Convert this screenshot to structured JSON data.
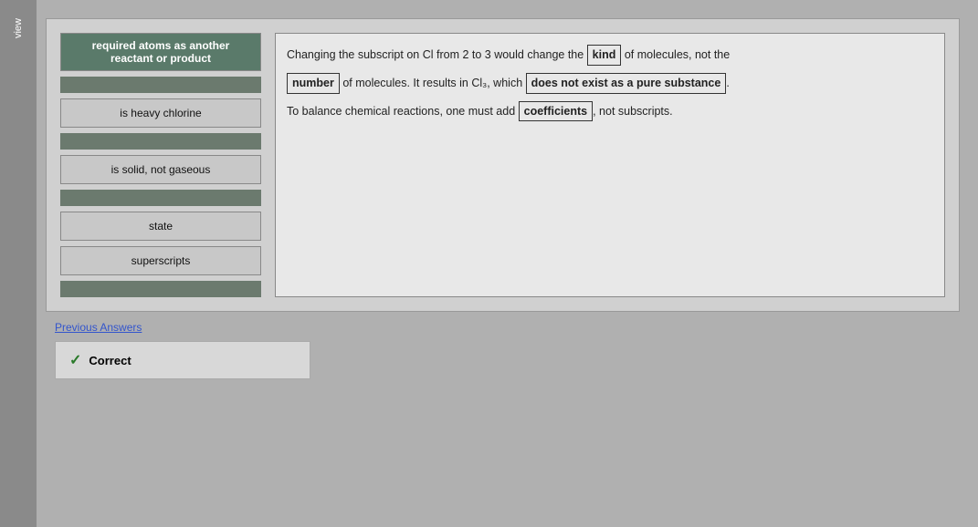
{
  "sidebar": {
    "label": "view"
  },
  "leftPanel": {
    "buttons": [
      {
        "id": "btn-reactant",
        "label": "required atoms as another\nreactant or product",
        "selected": true
      },
      {
        "id": "btn-heavy-chlorine",
        "label": "is heavy chlorine",
        "selected": false
      },
      {
        "id": "btn-solid",
        "label": "is solid, not gaseous",
        "selected": false
      },
      {
        "id": "btn-state",
        "label": "state",
        "selected": false
      },
      {
        "id": "btn-superscripts",
        "label": "superscripts",
        "selected": false
      }
    ]
  },
  "rightPanel": {
    "line1_pre": "Changing the subscript on Cl from 2 to 3 would change the ",
    "inline1": "kind",
    "line1_post": " of molecules, not the",
    "inline2": "number",
    "line2_mid": " of molecules. It results in Cl₃, which ",
    "inline3": "does not exist as a pure substance",
    "line3_pre": "To balance chemical reactions, one must add ",
    "inline4": "coefficients",
    "line3_post": ", not subscripts."
  },
  "footer": {
    "prev_answers_label": "Previous Answers",
    "correct_label": "Correct"
  }
}
